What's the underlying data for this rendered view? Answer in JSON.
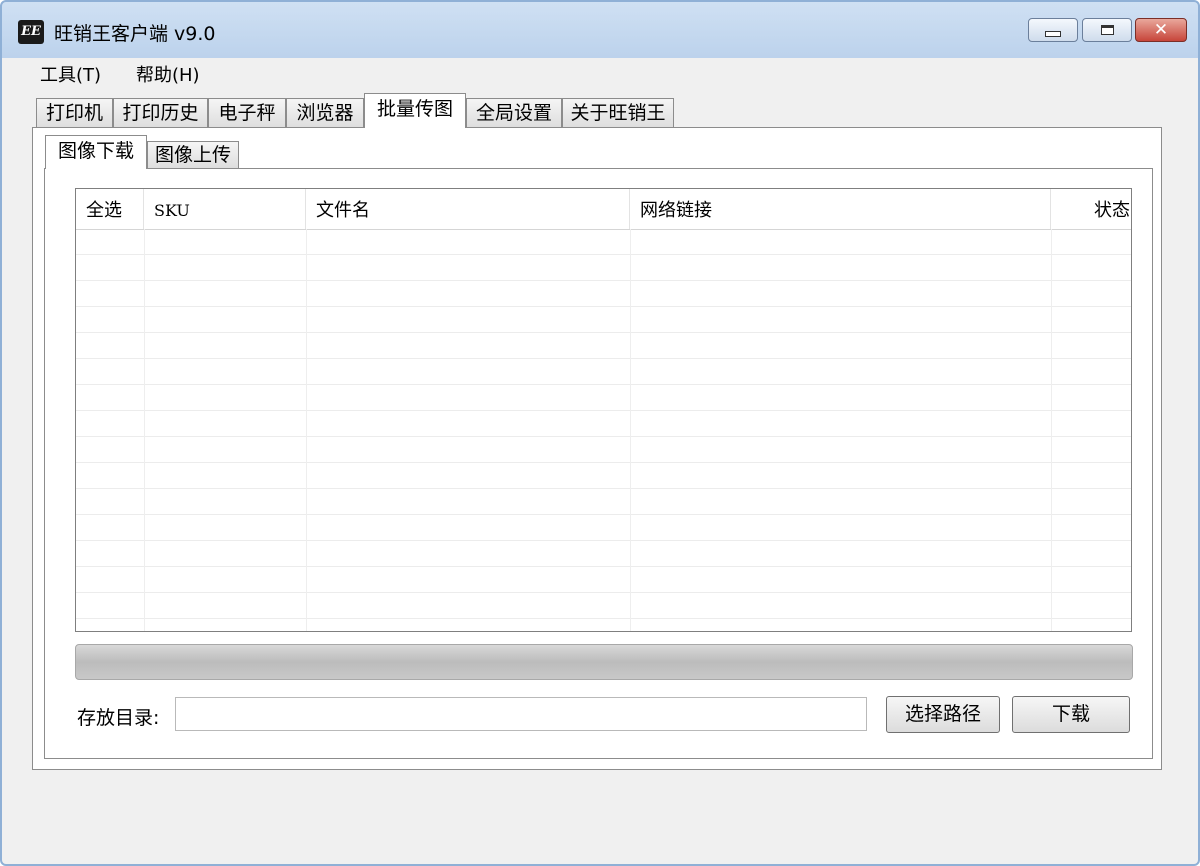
{
  "window": {
    "title": "旺销王客户端 v9.0",
    "icon_text": "EE"
  },
  "menu": {
    "items": [
      {
        "label": "工具(T)"
      },
      {
        "label": "帮助(H)"
      }
    ]
  },
  "main_tabs": [
    {
      "label": "打印机"
    },
    {
      "label": "打印历史"
    },
    {
      "label": "电子秤"
    },
    {
      "label": "浏览器"
    },
    {
      "label": "批量传图",
      "active": true
    },
    {
      "label": "全局设置"
    },
    {
      "label": "关于旺销王"
    }
  ],
  "sub_tabs": [
    {
      "label": "图像下载",
      "active": true
    },
    {
      "label": "图像上传"
    }
  ],
  "table": {
    "columns": [
      "全选",
      "SKU",
      "文件名",
      "网络链接",
      "状态"
    ],
    "rows": []
  },
  "progress": {
    "value": 0
  },
  "footer": {
    "dir_label": "存放目录:",
    "dir_value": "",
    "select_path_label": "选择路径",
    "download_label": "下载"
  },
  "colors": {
    "titlebar": "#bcd2ec",
    "close_button": "#c7453a",
    "progress_fill": "#39b54a"
  }
}
